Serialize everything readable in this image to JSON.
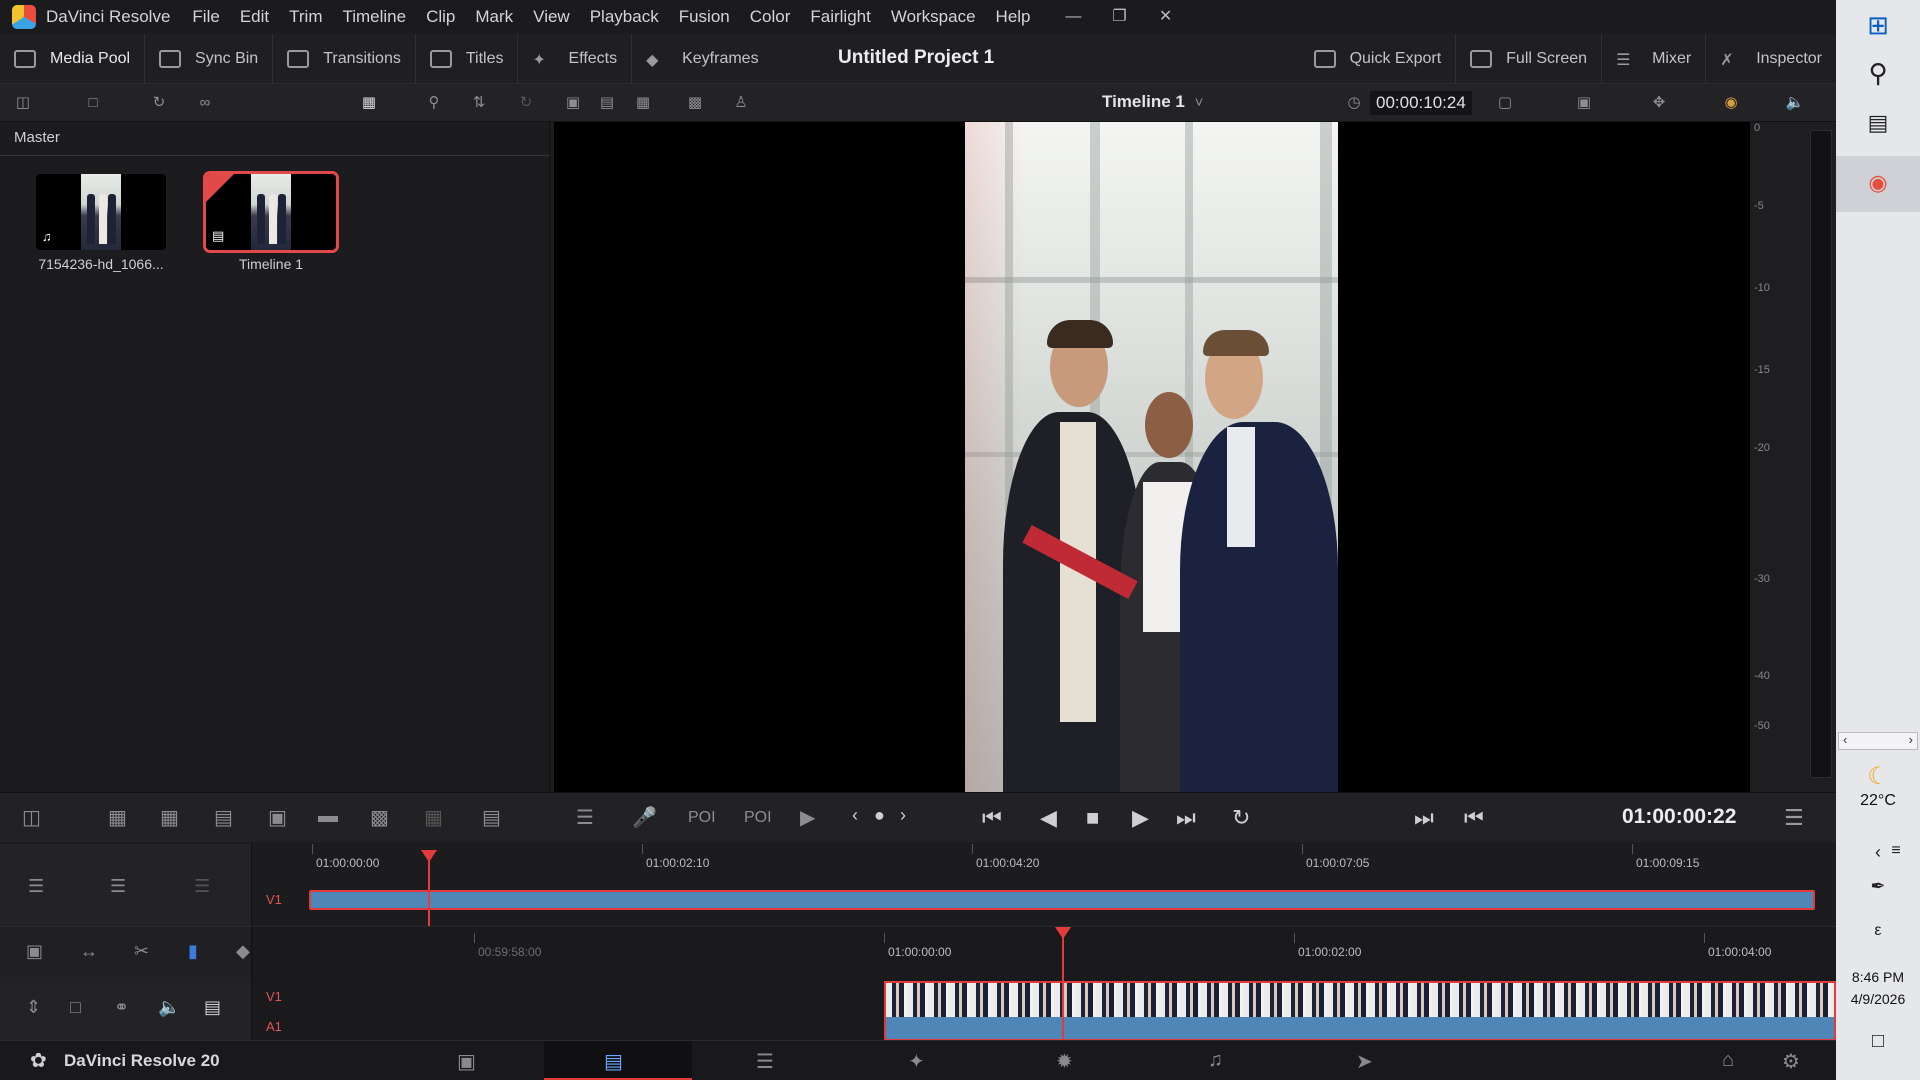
{
  "menubar": {
    "app": "DaVinci Resolve",
    "items": [
      "File",
      "Edit",
      "Trim",
      "Timeline",
      "Clip",
      "Mark",
      "View",
      "Playback",
      "Fusion",
      "Color",
      "Fairlight",
      "Workspace",
      "Help"
    ]
  },
  "toolbar": {
    "media_pool": "Media Pool",
    "sync_bin": "Sync Bin",
    "transitions": "Transitions",
    "titles": "Titles",
    "effects": "Effects",
    "keyframes": "Keyframes",
    "project_title": "Untitled Project 1",
    "quick_export": "Quick Export",
    "full_screen": "Full Screen",
    "mixer": "Mixer",
    "inspector": "Inspector"
  },
  "viewer": {
    "timeline_name": "Timeline 1",
    "timecode": "00:00:10:24",
    "current_timecode": "01:00:00:22"
  },
  "mediapool": {
    "bin": "Master",
    "clips": [
      {
        "name": "7154236-hd_1066...",
        "type": "audio-video"
      },
      {
        "name": "Timeline 1",
        "type": "timeline"
      }
    ]
  },
  "meter": {
    "ticks": [
      "0",
      "-5",
      "-10",
      "-15",
      "-20",
      "-30",
      "-40",
      "-50"
    ]
  },
  "timeline_upper": {
    "ruler": [
      "01:00:00:00",
      "01:00:02:10",
      "01:00:04:20",
      "01:00:07:05",
      "01:00:09:15"
    ],
    "track": "V1"
  },
  "timeline_lower": {
    "ruler": [
      "00:59:58:00",
      "01:00:00:00",
      "01:00:02:00",
      "01:00:04:00"
    ],
    "tracks": [
      "V1",
      "A1"
    ]
  },
  "pagebar": {
    "brand": "DaVinci Resolve 20"
  },
  "taskbar": {
    "temperature": "22°C",
    "time": "8:46 PM",
    "date": "4/9/2026",
    "ime": "ε"
  },
  "colors": {
    "accent_red": "#e33b3b",
    "clip_blue": "#4f86b8"
  }
}
